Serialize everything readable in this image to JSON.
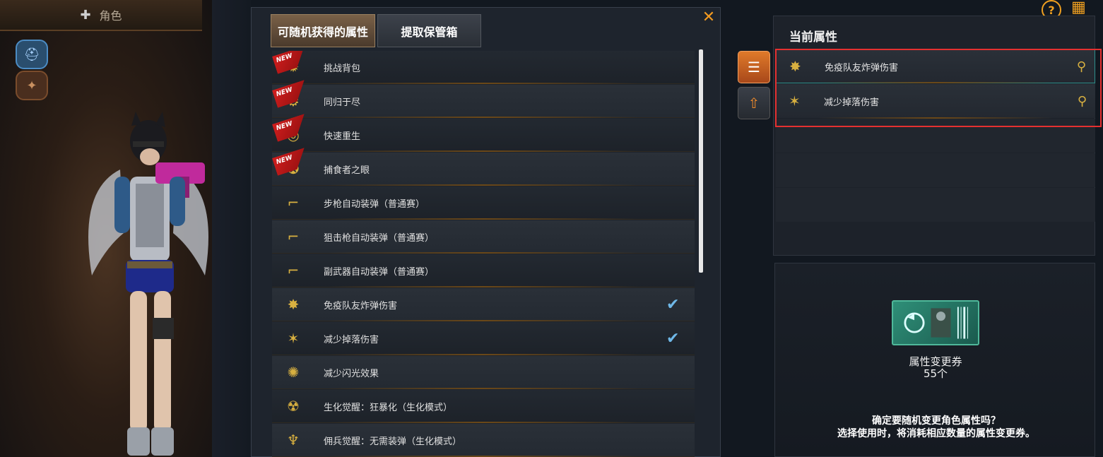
{
  "character_tab": {
    "label": "角色"
  },
  "tabs": [
    {
      "label": "可随机获得的属性",
      "active": true
    },
    {
      "label": "提取保管箱",
      "active": false
    }
  ],
  "attributes": [
    {
      "label": "挑战背包",
      "is_new": true,
      "checked": false,
      "icon": "backpack-icon"
    },
    {
      "label": "同归于尽",
      "is_new": true,
      "checked": false,
      "icon": "bomb-gear-icon"
    },
    {
      "label": "快速重生",
      "is_new": true,
      "checked": false,
      "icon": "respawn-icon"
    },
    {
      "label": "捕食者之眼",
      "is_new": true,
      "checked": false,
      "icon": "predator-eye-icon"
    },
    {
      "label": "步枪自动装弹（普通赛）",
      "is_new": false,
      "checked": false,
      "icon": "rifle-icon"
    },
    {
      "label": "狙击枪自动装弹（普通赛）",
      "is_new": false,
      "checked": false,
      "icon": "sniper-icon"
    },
    {
      "label": "副武器自动装弹（普通赛）",
      "is_new": false,
      "checked": false,
      "icon": "pistol-icon"
    },
    {
      "label": "免疫队友炸弹伤害",
      "is_new": false,
      "checked": true,
      "icon": "explosion-immunity-icon"
    },
    {
      "label": "减少掉落伤害",
      "is_new": false,
      "checked": true,
      "icon": "fall-damage-icon"
    },
    {
      "label": "减少闪光效果",
      "is_new": false,
      "checked": false,
      "icon": "flash-icon"
    },
    {
      "label": "生化觉醒：狂暴化（生化模式）",
      "is_new": false,
      "checked": false,
      "icon": "zombie-icon"
    },
    {
      "label": "佣兵觉醒：无需装弹（生化模式）",
      "is_new": false,
      "checked": false,
      "icon": "mercenary-icon"
    }
  ],
  "new_badge_text": "NEW",
  "current": {
    "title": "当前属性",
    "items": [
      {
        "label": "免疫队友炸弹伤害",
        "icon": "explosion-immunity-icon"
      },
      {
        "label": "减少掉落伤害",
        "icon": "fall-damage-icon"
      }
    ]
  },
  "coupon": {
    "name": "属性变更券",
    "count": "55个"
  },
  "confirm": {
    "question": "确定要随机变更角色属性吗？",
    "hint": "选择使用时，将消耗相应数量的属性变更券。"
  },
  "colors": {
    "accent": "#f0a020",
    "check": "#6fb8e8",
    "highlight_outline": "#e53030",
    "selected_border": "#2e8f8c"
  }
}
